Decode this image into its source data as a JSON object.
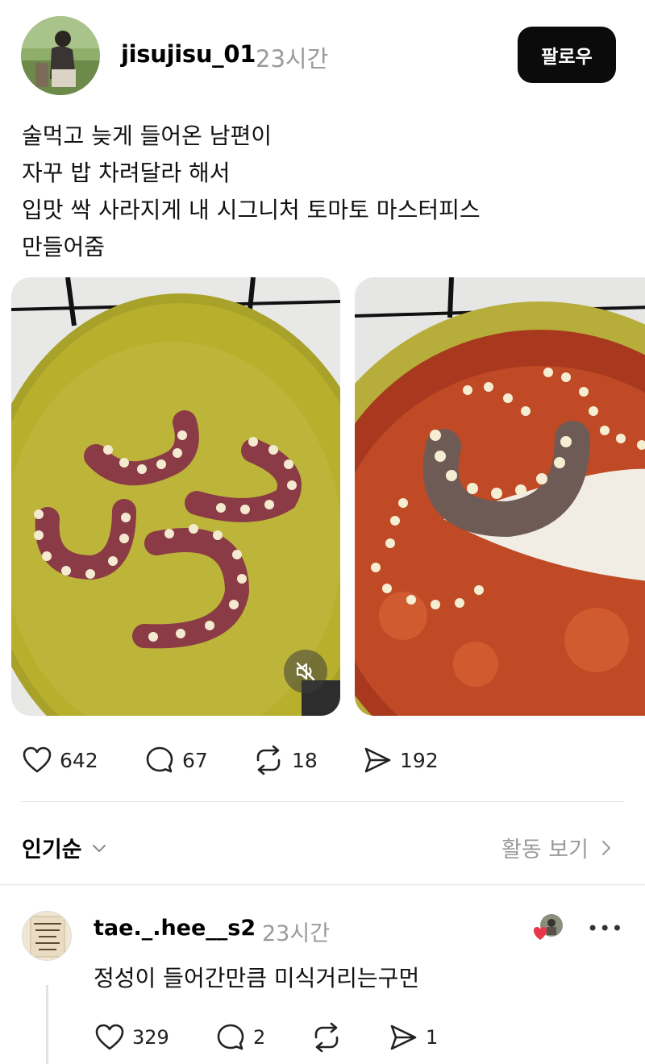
{
  "post": {
    "username": "jisujisu_01",
    "timestamp": "23시간",
    "follow_label": "팔로우",
    "text_lines": [
      "술먹고 늦게 들어온 남편이",
      "자꾸 밥 차려달라 해서",
      "입맛 싹 사라지게 내 시그니처 토마토 마스터피스",
      "만들어줌"
    ],
    "media": [
      {
        "icon": "video",
        "muted": true
      },
      {
        "icon": "video"
      }
    ],
    "stats": {
      "likes": "642",
      "comments": "67",
      "reposts": "18",
      "shares": "192"
    }
  },
  "comments_section": {
    "sort_label": "인기순",
    "activity_label": "활동 보기"
  },
  "comment": {
    "username": "tae._.hee__s2",
    "timestamp": "23시간",
    "avatar_text": "호랑이한테 물려가도 정신만 차려주면 살 수 있다",
    "text": "정성이 들어간만큼 미식거리는구먼",
    "more": "•••",
    "stats": {
      "likes": "329",
      "comments": "2",
      "shares": "1"
    }
  },
  "colors": {
    "follow_bg": "#0b0b0b",
    "muted_text": "#9a9a9a",
    "heart_red": "#e8364b"
  }
}
